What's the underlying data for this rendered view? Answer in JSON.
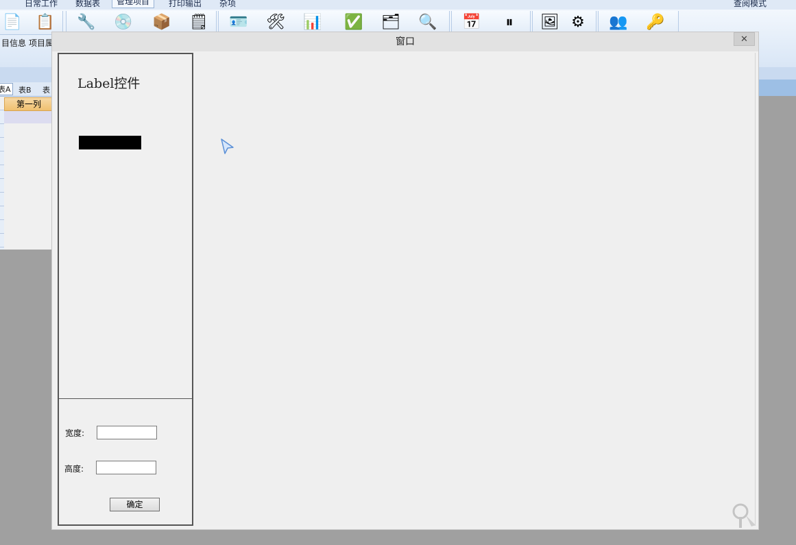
{
  "background_app": {
    "menu": [
      "日常工作",
      "数据表",
      "管理项目",
      "打印输出",
      "杂项"
    ],
    "active_menu_index": 2,
    "mode_label": "查阅模式",
    "ribbon_labels": [
      "目信息",
      "项目属"
    ],
    "sheet_tabs": [
      "表A",
      "表B",
      "表"
    ],
    "column_header": "第一列"
  },
  "dialog": {
    "title": "窗口",
    "close_glyph": "✕",
    "preview_label": "Label控件",
    "width_label": "宽度:",
    "width_value": "",
    "height_label": "高度:",
    "height_value": "",
    "confirm_label": "确定"
  },
  "colors": {
    "preview_box": "#000000",
    "panel_border": "#555555",
    "dialog_bg": "#f0f0f0"
  }
}
